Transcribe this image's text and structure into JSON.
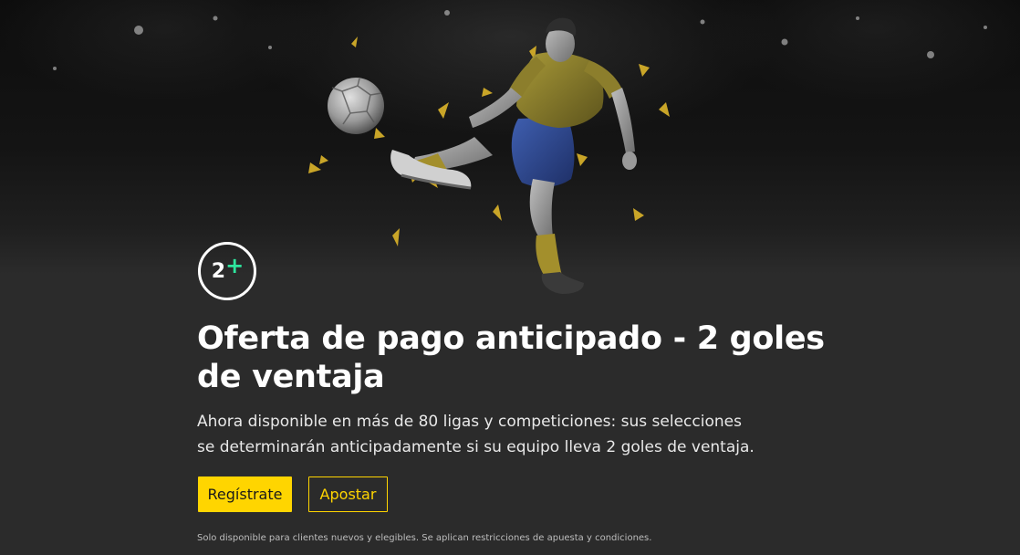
{
  "promo": {
    "badge": {
      "number": "2",
      "plus": "+"
    },
    "title": "Oferta de pago anticipado - 2 goles de ventaja",
    "description": "Ahora disponible en más de 80 ligas y competiciones: sus selecciones se determinarán anticipadamente si su equipo lleva 2 goles de ventaja.",
    "register_label": "Regístrate",
    "bet_label": "Apostar",
    "footnote": "Solo disponible para clientes nuevos y elegibles. Se aplican restricciones de apuesta y condiciones."
  },
  "colors": {
    "accent": "#ffd500",
    "badge_plus": "#2ee59d",
    "background": "#2b2b2b",
    "text": "#ffffff"
  },
  "images": {
    "hero": "football-player-kicking-ball-icon"
  }
}
